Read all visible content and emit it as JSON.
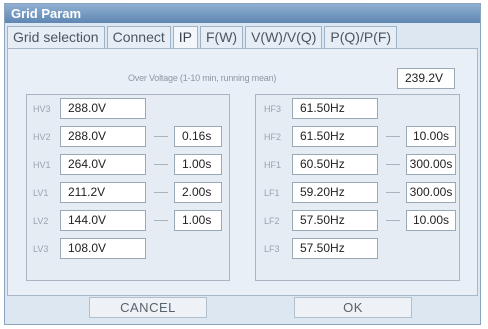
{
  "window": {
    "title": "Grid Param"
  },
  "tabs": [
    {
      "label": "Grid selection",
      "active": false
    },
    {
      "label": "Connect",
      "active": false
    },
    {
      "label": "IP",
      "active": true
    },
    {
      "label": "F(W)",
      "active": false
    },
    {
      "label": "V(W)/V(Q)",
      "active": false
    },
    {
      "label": "P(Q)/P(F)",
      "active": false
    }
  ],
  "over_voltage": {
    "label": "Over Voltage (1-10 min, running mean)",
    "value": "239.2V"
  },
  "voltage_rows": [
    {
      "label": "HV3",
      "value": "288.0V",
      "time": ""
    },
    {
      "label": "HV2",
      "value": "288.0V",
      "time": "0.16s"
    },
    {
      "label": "HV1",
      "value": "264.0V",
      "time": "1.00s"
    },
    {
      "label": "LV1",
      "value": "211.2V",
      "time": "2.00s"
    },
    {
      "label": "LV2",
      "value": "144.0V",
      "time": "1.00s"
    },
    {
      "label": "LV3",
      "value": "108.0V",
      "time": ""
    }
  ],
  "frequency_rows": [
    {
      "label": "HF3",
      "value": "61.50Hz",
      "time": ""
    },
    {
      "label": "HF2",
      "value": "61.50Hz",
      "time": "10.00s"
    },
    {
      "label": "HF1",
      "value": "60.50Hz",
      "time": "300.00s"
    },
    {
      "label": "LF1",
      "value": "59.20Hz",
      "time": "300.00s"
    },
    {
      "label": "LF2",
      "value": "57.50Hz",
      "time": "10.00s"
    },
    {
      "label": "LF3",
      "value": "57.50Hz",
      "time": ""
    }
  ],
  "buttons": {
    "cancel": "CANCEL",
    "ok": "OK"
  }
}
